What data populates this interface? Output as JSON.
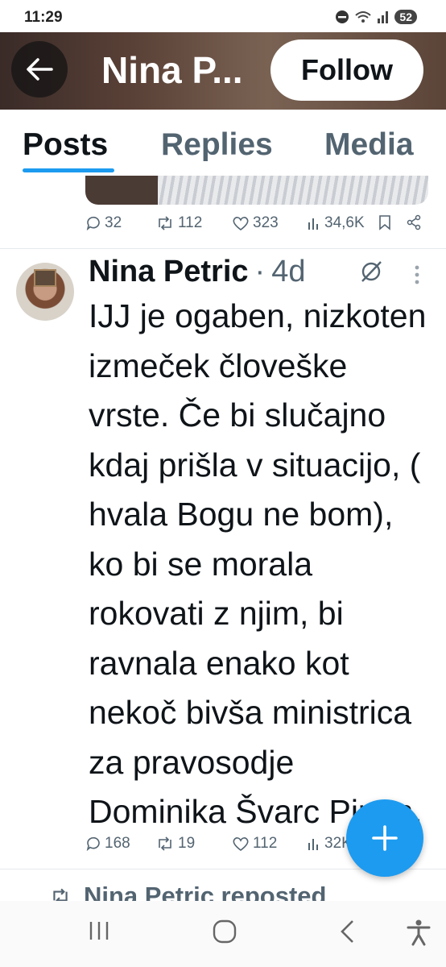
{
  "status": {
    "time": "11:29",
    "battery": "52",
    "icons": [
      "dnd-icon",
      "wifi-icon",
      "signal-icon",
      "battery-icon"
    ]
  },
  "header": {
    "back_icon": "arrow-left-icon",
    "title": "Nina P...",
    "follow_label": "Follow"
  },
  "tabs": [
    {
      "label": "Posts",
      "active": true
    },
    {
      "label": "Replies",
      "active": false
    },
    {
      "label": "Media",
      "active": false
    }
  ],
  "previous_tweet": {
    "replies": "32",
    "reposts": "112",
    "likes": "323",
    "views": "34,6K"
  },
  "tweet": {
    "author": "Nina Petric",
    "separator": "·",
    "time": "4d",
    "text": "IJJ je ogaben, nizkoten izmeček človeške vrste. Če bi slučajno kdaj prišla v situacijo, ( hvala Bogu ne bom),  ko bi se morala rokovati z njim, bi ravnala enako kot nekoč bivša ministrica za pravosodje Dominika Švarc Pipan.",
    "replies": "168",
    "reposts": "19",
    "likes": "112",
    "views": "32K"
  },
  "next_item": {
    "repost_label": "Nina Petric reposted"
  },
  "colors": {
    "accent": "#1d9bf0",
    "text": "#0f1419",
    "muted": "#536471"
  }
}
